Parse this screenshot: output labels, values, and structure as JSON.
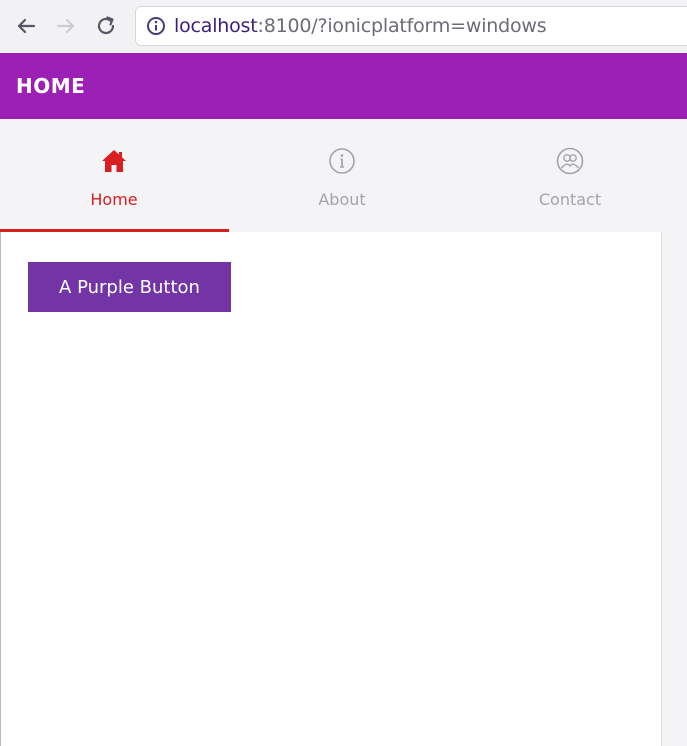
{
  "browser": {
    "url_host": "localhost",
    "url_rest": ":8100/?ionicplatform=windows",
    "icons": {
      "back": "arrow-left-icon",
      "forward": "arrow-right-icon",
      "reload": "reload-icon",
      "info": "info-icon"
    }
  },
  "header": {
    "title": "HOME",
    "background": "#9c20b5"
  },
  "tabs": [
    {
      "label": "Home",
      "icon": "home-icon",
      "active": true
    },
    {
      "label": "About",
      "icon": "info-circle-icon",
      "active": false
    },
    {
      "label": "Contact",
      "icon": "contacts-icon",
      "active": false
    }
  ],
  "colors": {
    "active_tab": "#d81e1e",
    "inactive_tab": "#a6a2ad",
    "button": "#7334a6"
  },
  "content": {
    "button_label": "A Purple Button"
  }
}
